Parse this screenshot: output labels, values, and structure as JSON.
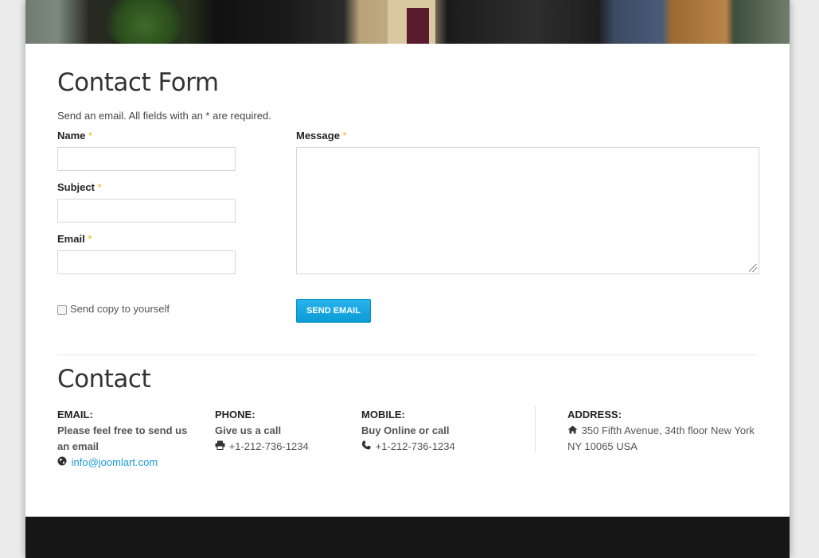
{
  "form": {
    "title": "Contact Form",
    "intro": "Send an email. All fields with an * are required.",
    "required_mark": "*",
    "name_label": "Name",
    "subject_label": "Subject",
    "email_label": "Email",
    "message_label": "Message",
    "name_value": "",
    "subject_value": "",
    "email_value": "",
    "message_value": "",
    "copy_label": "Send copy to yourself",
    "copy_checked": false,
    "send_label": "Send Email"
  },
  "contact": {
    "title": "Contact",
    "email": {
      "heading": "EMAIL:",
      "text": "Please feel free to send us an email",
      "address": "info@joomlart.com"
    },
    "phone": {
      "heading": "PHONE:",
      "text": "Give us a call",
      "number": "+1-212-736-1234"
    },
    "mobile": {
      "heading": "MOBILE:",
      "text": "Buy Online or call",
      "number": "+1-212-736-1234"
    },
    "address": {
      "heading": "ADDRESS:",
      "text": "350 Fifth Avenue, 34th floor New York NY 10065 USA"
    }
  },
  "icons": {
    "globe": "globe-icon",
    "print": "printer-icon",
    "phone": "phone-icon",
    "home": "home-icon",
    "resize": "resize-handle-icon"
  },
  "colors": {
    "accent": "#1a9bd7",
    "button": "#0a9bd6",
    "required": "#f0b400",
    "footer": "#161616"
  }
}
